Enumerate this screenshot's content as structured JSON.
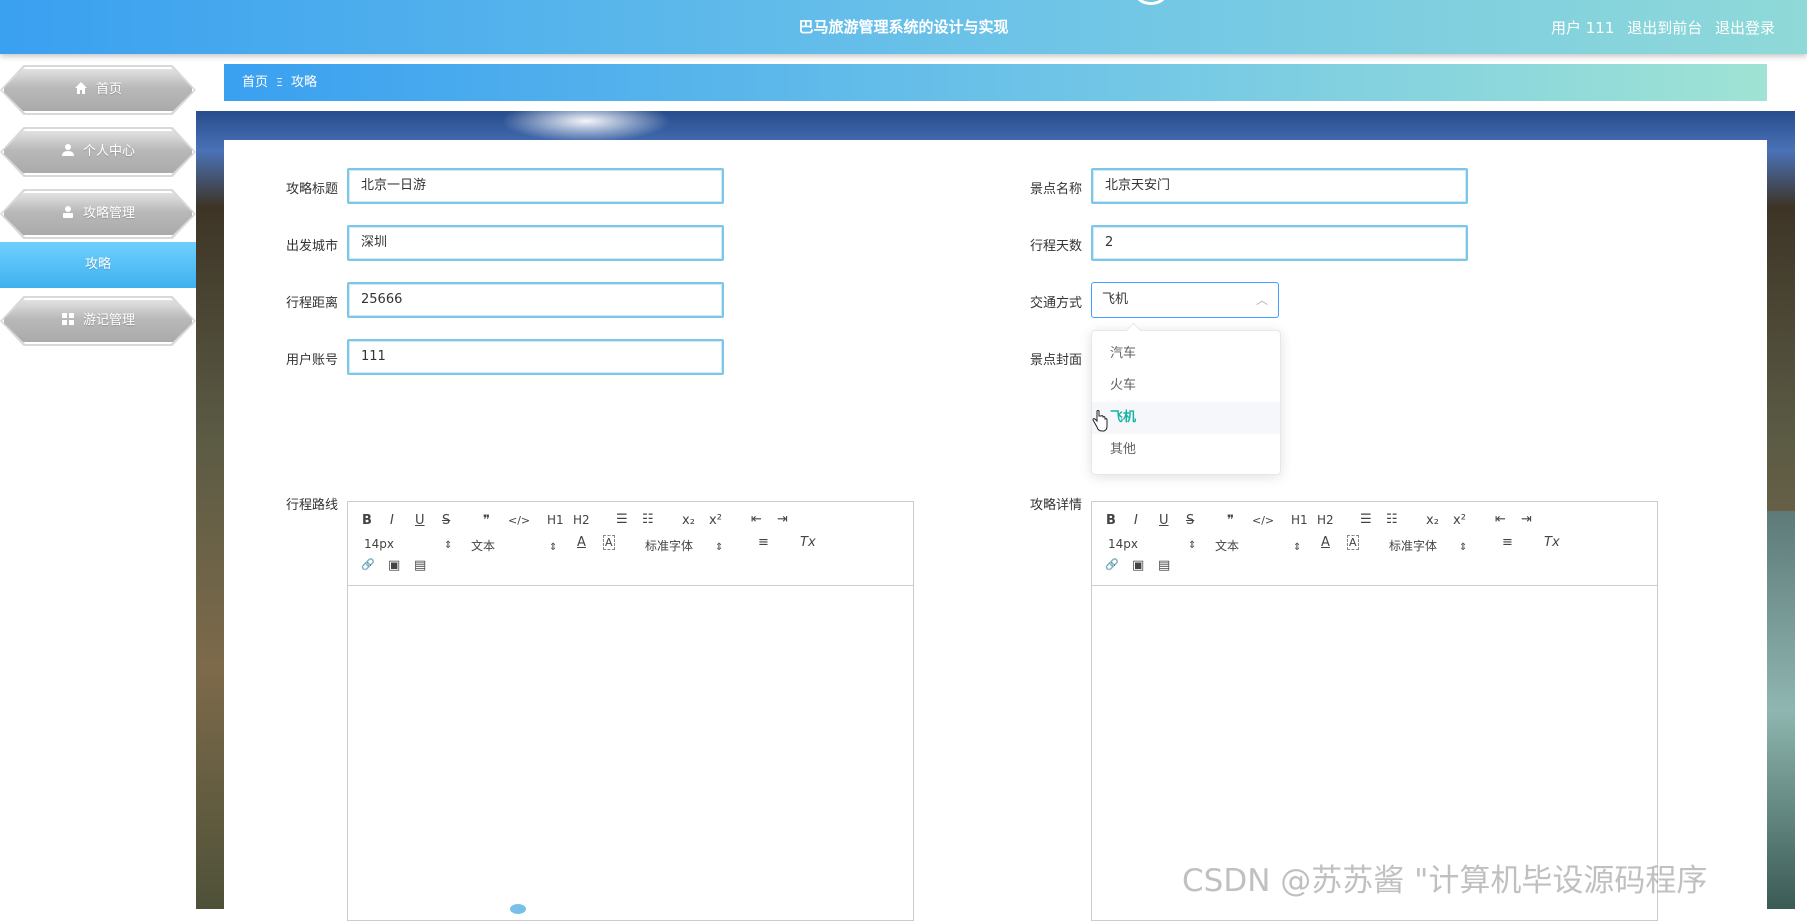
{
  "header": {
    "title": "巴马旅游管理系统的设计与实现",
    "user_label": "用户 111",
    "to_front": "退出到前台",
    "logout": "退出登录"
  },
  "sidebar": {
    "items": [
      {
        "label": "首页",
        "icon": "home-icon"
      },
      {
        "label": "个人中心",
        "icon": "user-icon"
      },
      {
        "label": "攻略管理",
        "icon": "user-badge-icon"
      },
      {
        "label": "攻略",
        "icon": ""
      },
      {
        "label": "游记管理",
        "icon": "grid-icon"
      }
    ]
  },
  "breadcrumb": {
    "home": "首页",
    "separator": "Ξ",
    "current": "攻略"
  },
  "form": {
    "title_label": "攻略标题",
    "title_value": "北京一日游",
    "scenic_label": "景点名称",
    "scenic_value": "北京天安门",
    "city_label": "出发城市",
    "city_value": "深圳",
    "days_label": "行程天数",
    "days_value": "2",
    "distance_label": "行程距离",
    "distance_value": "25666",
    "transport_label": "交通方式",
    "transport_value": "飞机",
    "account_label": "用户账号",
    "account_value": "111",
    "cover_label": "景点封面",
    "route_label": "行程路线",
    "detail_label": "攻略详情"
  },
  "transport_options": [
    "汽车",
    "火车",
    "飞机",
    "其他"
  ],
  "editor_toolbar": {
    "bold": "B",
    "italic": "I",
    "underline": "U",
    "strike": "S",
    "quote": "❞",
    "code": "</>",
    "h1": "H1",
    "h2": "H2",
    "ordered": "☰",
    "bullet": "☷",
    "sub": "x₂",
    "sup": "x²",
    "outdent": "⇤",
    "indent": "⇥",
    "size": "14px",
    "text": "文本",
    "color": "A",
    "bg": "A",
    "font": "标准字体",
    "align": "≡",
    "clean": "Tx",
    "link": "🔗",
    "image": "▣",
    "video": "▤"
  },
  "watermark": "CSDN @苏苏酱    \"计算机毕设源码程序"
}
